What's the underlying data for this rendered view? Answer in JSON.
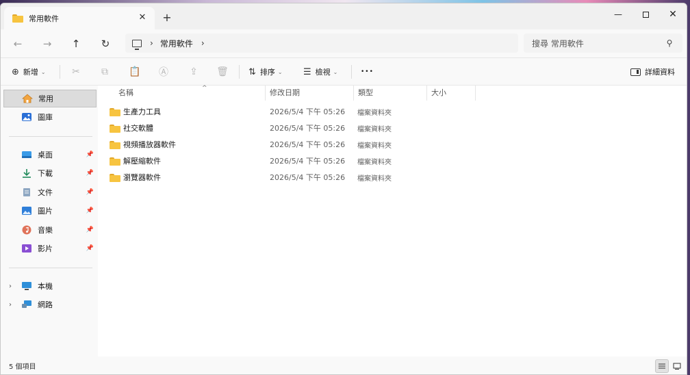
{
  "tab": {
    "title": "常用軟件",
    "close": "✕",
    "new": "+"
  },
  "window_controls": {
    "minimize": "—",
    "close": "✕"
  },
  "nav": {
    "back": "←",
    "forward": "→",
    "up": "↑",
    "refresh": "↻",
    "breadcrumb": [
      "常用軟件"
    ],
    "sep": "›",
    "search_placeholder": "搜尋 常用軟件",
    "search_icon_glyph": "⚲"
  },
  "commands": {
    "new_label": "新增",
    "new_icon": "⊕",
    "sort_label": "排序",
    "sort_icon": "⇅",
    "view_label": "檢視",
    "view_icon": "☰",
    "more": "•••",
    "details_label": "詳細資料",
    "chevron": "⌄",
    "disabled_icons": [
      "cut-icon",
      "copy-icon",
      "paste-icon",
      "rename-icon",
      "share-icon",
      "delete-icon"
    ],
    "disabled_glyphs": [
      "✂",
      "⧉",
      "📋",
      "Ⓐ",
      "⇪",
      "🗑"
    ]
  },
  "sidebar": {
    "top": [
      {
        "label": "常用",
        "icon": "home-icon"
      },
      {
        "label": "圖庫",
        "icon": "gallery-icon"
      }
    ],
    "pinned": [
      {
        "label": "桌面",
        "icon": "desktop-icon"
      },
      {
        "label": "下載",
        "icon": "download-icon"
      },
      {
        "label": "文件",
        "icon": "documents-icon"
      },
      {
        "label": "圖片",
        "icon": "pictures-icon"
      },
      {
        "label": "音樂",
        "icon": "music-icon"
      },
      {
        "label": "影片",
        "icon": "videos-icon"
      }
    ],
    "bottom": [
      {
        "label": "本機",
        "icon": "this-pc-icon"
      },
      {
        "label": "網路",
        "icon": "network-icon"
      }
    ],
    "pin_glyph": "📌",
    "expand_glyph": "›"
  },
  "columns": {
    "name": "名稱",
    "date": "修改日期",
    "type": "類型",
    "size": "大小",
    "sort_caret": "^"
  },
  "files": [
    {
      "name": "生產力工具",
      "date": "2026/5/4 下午 05:26",
      "type": "檔案資料夾"
    },
    {
      "name": "社交軟體",
      "date": "2026/5/4 下午 05:26",
      "type": "檔案資料夾"
    },
    {
      "name": "視頻播放器軟件",
      "date": "2026/5/4 下午 05:26",
      "type": "檔案資料夾"
    },
    {
      "name": "解壓縮軟件",
      "date": "2026/5/4 下午 05:26",
      "type": "檔案資料夾"
    },
    {
      "name": "瀏覽器軟件",
      "date": "2026/5/4 下午 05:26",
      "type": "檔案資料夾"
    }
  ],
  "status": {
    "item_count": "5 個項目"
  },
  "colors": {
    "folder": "#f7c440",
    "folder_back": "#e2a72a",
    "selected": "#dcdcdc"
  }
}
